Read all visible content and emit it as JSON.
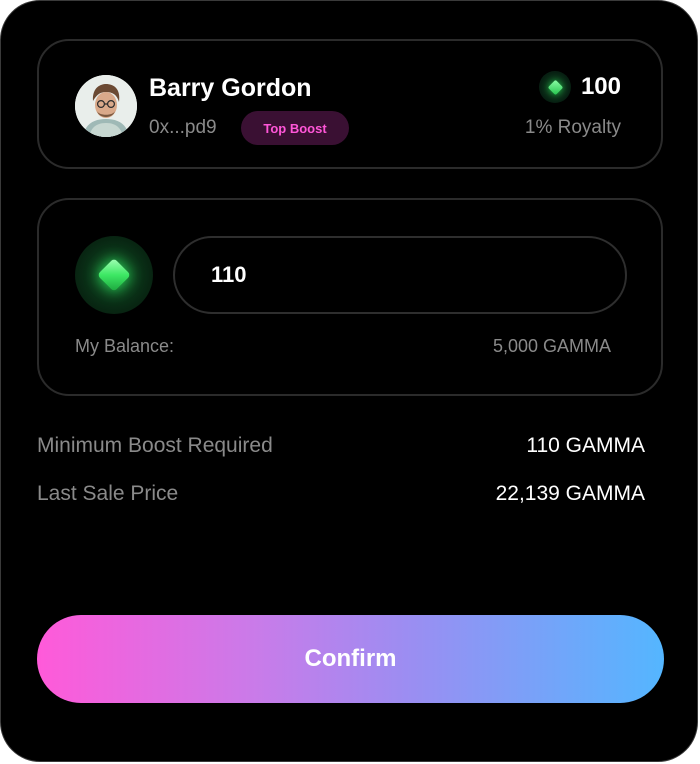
{
  "seller": {
    "name": "Barry Gordon",
    "address": "0x...pd9",
    "badge": "Top Boost",
    "price": "100",
    "royalty": "1% Royalty"
  },
  "boost": {
    "amount": "110",
    "balance_label": "My Balance:",
    "balance_value": "5,000 GAMMA"
  },
  "details": {
    "min_boost_label": "Minimum Boost Required",
    "min_boost_value": "110 GAMMA",
    "last_sale_label": "Last Sale Price",
    "last_sale_value": "22,139 GAMMA"
  },
  "actions": {
    "confirm_label": "Confirm"
  },
  "colors": {
    "accent_pink": "#ff56d8",
    "accent_blue": "#54b6ff",
    "gem_green": "#27d255"
  }
}
